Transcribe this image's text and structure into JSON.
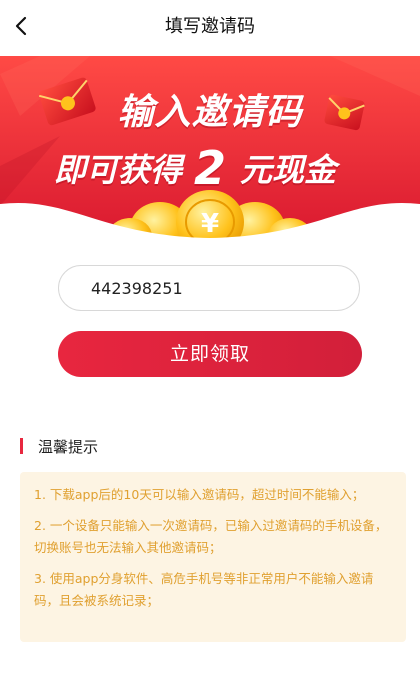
{
  "nav": {
    "title": "填写邀请码",
    "back_icon": "chevron-left-icon"
  },
  "banner": {
    "line1": "输入邀请码",
    "line2_prefix": "即可获得",
    "line2_amount": "2",
    "line2_suffix": "元现金",
    "colors": {
      "bg_top": "#ff3a3f",
      "bg_bottom": "#d8172f",
      "coin": "#ffc21c"
    },
    "decorations": [
      "red-envelope-icon",
      "red-envelope-icon",
      "gold-coin-icon"
    ]
  },
  "form": {
    "invite_code_value": "442398251",
    "invite_code_placeholder": "",
    "claim_label": "立即领取"
  },
  "tips": {
    "title": "温馨提示",
    "items": [
      "1. 下载app后的10天可以输入邀请码，超过时间不能输入；",
      "2. 一个设备只能输入一次邀请码，已输入过邀请码的手机设备，切换账号也无法输入其他邀请码；",
      "3. 使用app分身软件、高危手机号等非正常用户不能输入邀请码，且会被系统记录；"
    ]
  },
  "colors": {
    "accent": "#e8263f",
    "tip_text": "#e0a030",
    "tip_bg": "#fdf4e3"
  }
}
